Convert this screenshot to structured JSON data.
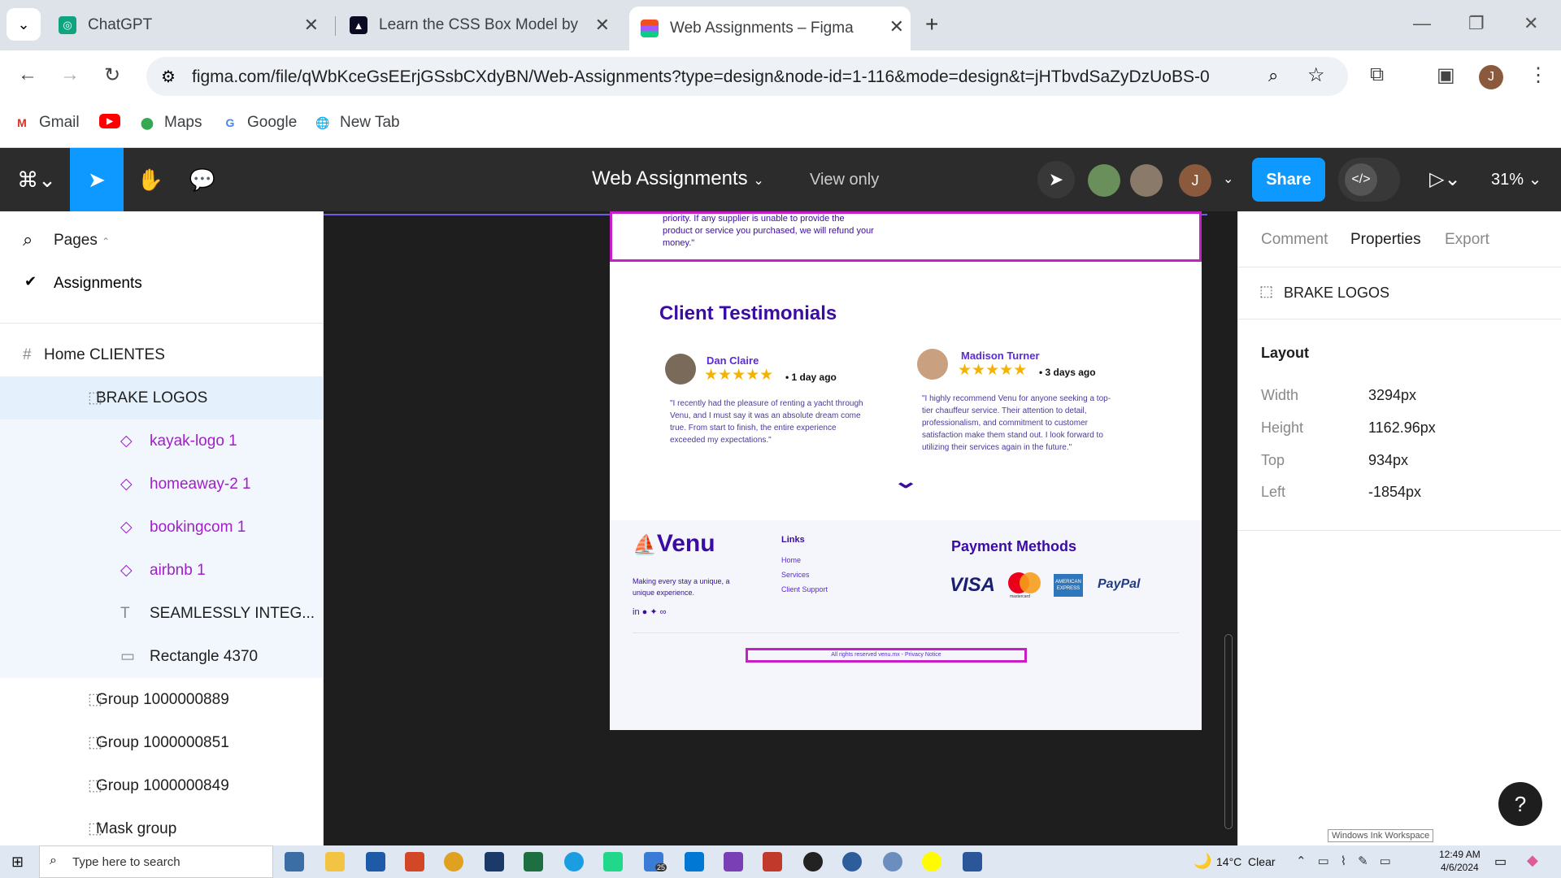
{
  "browser": {
    "tabs": [
      {
        "title": "ChatGPT"
      },
      {
        "title": "Learn the CSS Box Model by Bu"
      },
      {
        "title": "Web Assignments – Figma"
      }
    ],
    "url": "figma.com/file/qWbKceGsEErjGSsbCXdyBN/Web-Assignments?type=design&node-id=1-116&mode=design&t=jHTbvdSaZyDzUoBS-0",
    "profile_initial": "J",
    "bookmarks": [
      "Gmail",
      "Maps",
      "Google",
      "New Tab"
    ]
  },
  "figma": {
    "file_name": "Web Assignments",
    "mode": "View only",
    "share_label": "Share",
    "zoom": "31%",
    "avatar_initial": "J"
  },
  "left_panel": {
    "pages_label": "Pages",
    "current_page": "Assignments",
    "layers": [
      {
        "name": "Home CLIENTES",
        "icon": "#"
      },
      {
        "name": "BRAKE LOGOS",
        "icon": "frame"
      },
      {
        "name": "kayak-logo 1",
        "icon": "component"
      },
      {
        "name": "homeaway-2 1",
        "icon": "component"
      },
      {
        "name": "bookingcom 1",
        "icon": "component"
      },
      {
        "name": "airbnb 1",
        "icon": "component"
      },
      {
        "name": "SEAMLESSLY INTEG...",
        "icon": "T"
      },
      {
        "name": "Rectangle 4370",
        "icon": "rect"
      },
      {
        "name": "Group 1000000889",
        "icon": "frame"
      },
      {
        "name": "Group 1000000851",
        "icon": "frame"
      },
      {
        "name": "Group 1000000849",
        "icon": "frame"
      },
      {
        "name": "Mask group",
        "icon": "frame"
      }
    ]
  },
  "canvas": {
    "top_text": [
      "priority. If any supplier is unable to provide the",
      "product or service you purchased, we will refund your",
      "money.\""
    ],
    "testimonials_title": "Client Testimonials",
    "reviews": [
      {
        "name": "Dan Claire",
        "ago": "• 1 day ago",
        "stars": 5,
        "text": [
          "\"I recently had the pleasure of renting a yacht through",
          "Venu, and I must say it was an absolute dream come",
          "true. From start to finish, the entire experience",
          "exceeded my expectations.\""
        ]
      },
      {
        "name": "Madison Turner",
        "ago": "• 3 days ago",
        "stars": 5,
        "text": [
          "\"I highly recommend Venu for anyone seeking a top-",
          "tier chauffeur service. Their attention to detail,",
          "professionalism, and commitment to customer",
          "satisfaction make them stand out. I look forward to",
          "utilizing their services again in the future.\""
        ]
      }
    ],
    "footer": {
      "brand": "Venu",
      "tagline": [
        "Making every stay a unique, a",
        "unique experience."
      ],
      "links_title": "Links",
      "links": [
        "Home",
        "Services",
        "Client Support"
      ],
      "payment_title": "Payment Methods",
      "payments": [
        "VISA",
        "mastercard",
        "AMERICAN EXPRESS",
        "PayPal"
      ],
      "copyright": "All rights reserved venu.mx - Privacy Notice"
    }
  },
  "right_panel": {
    "tabs": [
      "Comment",
      "Properties",
      "Export"
    ],
    "selection": "BRAKE LOGOS",
    "section": "Layout",
    "props": [
      {
        "label": "Width",
        "value": "3294px"
      },
      {
        "label": "Height",
        "value": "1162.96px"
      },
      {
        "label": "Top",
        "value": "934px"
      },
      {
        "label": "Left",
        "value": "-1854px"
      }
    ],
    "ink_tooltip": "Windows Ink Workspace"
  },
  "taskbar": {
    "search_placeholder": "Type here to search",
    "weather": "14°C  Clear",
    "time": "12:49 AM",
    "date": "4/6/2024",
    "mail_badge": "25"
  },
  "colors": {
    "figma_bar": "#2c2c2c",
    "accent_blue": "#0d99ff",
    "select_purple": "#c81ec8",
    "venu_purple": "#3a0ca3",
    "star_gold": "#f5b301"
  }
}
